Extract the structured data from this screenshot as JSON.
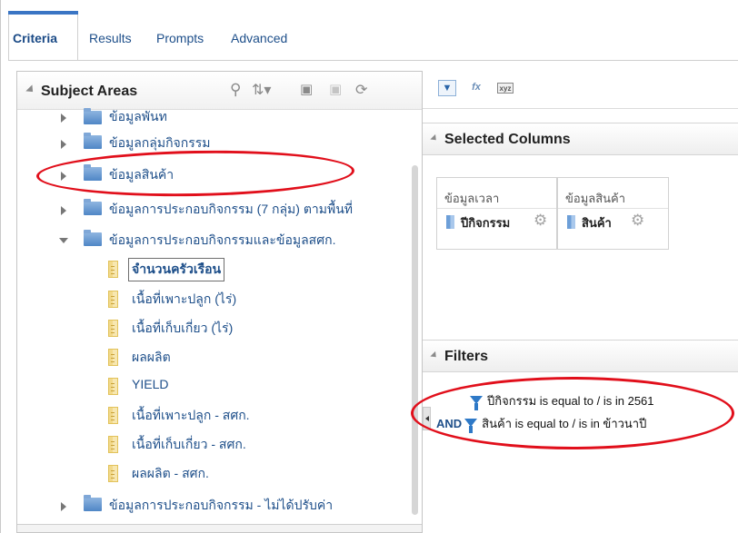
{
  "tabs": [
    {
      "label": "Criteria",
      "active": true
    },
    {
      "label": "Results",
      "active": false
    },
    {
      "label": "Prompts",
      "active": false
    },
    {
      "label": "Advanced",
      "active": false
    }
  ],
  "subject_areas": {
    "title": "Subject Areas",
    "toolbar_icons": [
      "search-icon",
      "sort-icon",
      "select-columns-icon",
      "deselect-icon",
      "refresh-icon"
    ],
    "items": [
      {
        "label": "ข้อมูลพันท",
        "type": "folder",
        "expanded": false
      },
      {
        "label": "ข้อมูลกลุ่มกิจกรรม",
        "type": "folder",
        "expanded": false
      },
      {
        "label": "ข้อมูลสินค้า",
        "type": "folder",
        "expanded": false
      },
      {
        "label": "ข้อมูลการประกอบกิจกรรม (7 กลุ่ม) ตามพื้นที่",
        "type": "folder",
        "expanded": false
      },
      {
        "label": "ข้อมูลการประกอบกิจกรรมและข้อมูลสศก.",
        "type": "folder",
        "expanded": true
      },
      {
        "label": "จำนวนครัวเรือน",
        "type": "column",
        "selected": true
      },
      {
        "label": "เนื้อที่เพาะปลูก (ไร่)",
        "type": "column"
      },
      {
        "label": "เนื้อที่เก็บเกี่ยว (ไร่)",
        "type": "column"
      },
      {
        "label": "ผลผลิต",
        "type": "column"
      },
      {
        "label": "YIELD",
        "type": "column"
      },
      {
        "label": "เนื้อที่เพาะปลูก - สศก.",
        "type": "column"
      },
      {
        "label": "เนื้อที่เก็บเกี่ยว - สศก.",
        "type": "column"
      },
      {
        "label": "ผลผลิต - สศก.",
        "type": "column"
      },
      {
        "label": "ข้อมูลการประกอบกิจกรรม - ไม่ได้ปรับค่า",
        "type": "folder",
        "expanded": false
      }
    ]
  },
  "right_toolbar": {
    "icons": [
      "filter-icon",
      "formula-icon",
      "xyz-icon"
    ],
    "xyz_label": "xyz"
  },
  "selected_columns": {
    "title": "Selected Columns",
    "columns": [
      {
        "folder": "ข้อมูลเวลา",
        "column": "ปีกิจกรรม"
      },
      {
        "folder": "ข้อมูลสินค้า",
        "column": "สินค้า"
      }
    ]
  },
  "filters": {
    "title": "Filters",
    "rows": [
      {
        "prefix": "",
        "text": "ปีกิจกรรม is equal to / is in  2561"
      },
      {
        "prefix": "AND",
        "text": "สินค้า is equal to / is in  ข้าวนาปี"
      }
    ]
  },
  "colors": {
    "accent": "#3a75c4",
    "link": "#1e4f8a",
    "annotation": "#e10f1b"
  }
}
